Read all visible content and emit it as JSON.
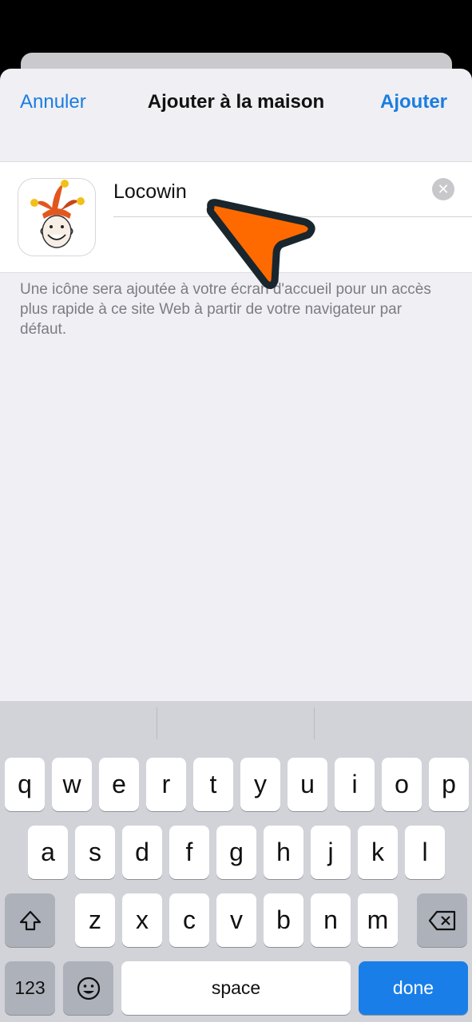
{
  "navbar": {
    "cancel_label": "Annuler",
    "title": "Ajouter à la maison",
    "add_label": "Ajouter"
  },
  "shortcut": {
    "name_value": "Locowin",
    "icon": "jester-app-icon",
    "description": "Une icône sera ajoutée à votre écran d'accueil pour un accès plus rapide à ce site Web à partir de votre navigateur par défaut."
  },
  "keyboard": {
    "row1": [
      "q",
      "w",
      "e",
      "r",
      "t",
      "y",
      "u",
      "i",
      "o",
      "p"
    ],
    "row2": [
      "a",
      "s",
      "d",
      "f",
      "g",
      "h",
      "j",
      "k",
      "l"
    ],
    "row3": [
      "z",
      "x",
      "c",
      "v",
      "b",
      "n",
      "m"
    ],
    "numbers_label": "123",
    "space_label": "space",
    "done_label": "done",
    "shift_icon": "shift-icon",
    "backspace_icon": "backspace-icon",
    "emoji_icon": "emoji-icon"
  },
  "colors": {
    "accent": "#1a7de0",
    "cursor": "#ff6a00"
  }
}
